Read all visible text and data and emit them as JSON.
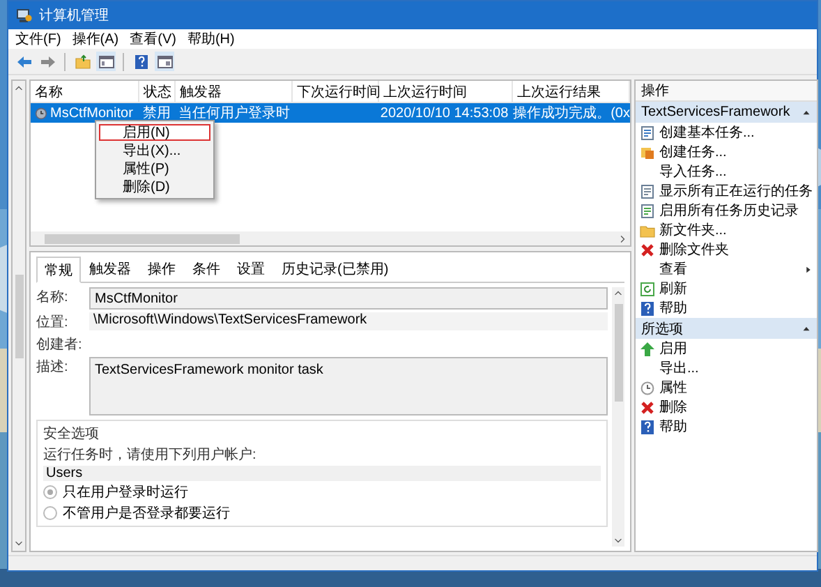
{
  "window": {
    "title": "计算机管理"
  },
  "menu": [
    "文件(F)",
    "操作(A)",
    "查看(V)",
    "帮助(H)"
  ],
  "task_list": {
    "columns": [
      "名称",
      "状态",
      "触发器",
      "下次运行时间",
      "上次运行时间",
      "上次运行结果"
    ],
    "rows": [
      {
        "name": "MsCtfMonitor",
        "status": "禁用",
        "trigger": "当任何用户登录时",
        "last_run": "2020/10/10 14:53:08",
        "last_result": "操作成功完成。(0x",
        "selected": true
      }
    ]
  },
  "context_menu": [
    {
      "label": "启用(N)",
      "selected": true
    },
    {
      "label": "导出(X)...",
      "selected": false
    },
    {
      "label": "属性(P)",
      "selected": false
    },
    {
      "label": "删除(D)",
      "selected": false
    }
  ],
  "details": {
    "tabs": [
      {
        "label": "常规",
        "selected": true
      },
      {
        "label": "触发器",
        "selected": false
      },
      {
        "label": "操作",
        "selected": false
      },
      {
        "label": "条件",
        "selected": false
      },
      {
        "label": "设置",
        "selected": false
      },
      {
        "label": "历史记录(已禁用)",
        "selected": false
      }
    ],
    "fields": [
      {
        "label": "名称:",
        "value": "MsCtfMonitor",
        "kind": "input"
      },
      {
        "label": "位置:",
        "value": "\\Microsoft\\Windows\\TextServicesFramework",
        "kind": "readonly"
      },
      {
        "label": "创建者:",
        "kind": "readonly"
      },
      {
        "label": "描述:",
        "value": "TextServicesFramework monitor task",
        "kind": "textarea"
      }
    ],
    "security": {
      "title": "安全选项",
      "prompt": "运行任务时，请使用下列用户帐户:",
      "account": "Users",
      "options": [
        {
          "label": "只在用户登录时运行",
          "selected": true
        },
        {
          "label": "不管用户是否登录都要运行",
          "selected": false
        }
      ]
    }
  },
  "actions": {
    "title": "操作",
    "sections": [
      {
        "title": "TextServicesFramework",
        "expanded": true,
        "items": [
          {
            "label": "创建基本任务...",
            "kind": "action"
          },
          {
            "label": "创建任务...",
            "kind": "action"
          },
          {
            "label": "导入任务...",
            "kind": "action"
          },
          {
            "label": "显示所有正在运行的任务",
            "kind": "action"
          },
          {
            "label": "启用所有任务历史记录",
            "kind": "action"
          },
          {
            "label": "新文件夹...",
            "kind": "action"
          },
          {
            "label": "删除文件夹",
            "kind": "action"
          },
          {
            "label": "查看",
            "kind": "submenu"
          },
          {
            "label": "刷新",
            "kind": "action"
          },
          {
            "label": "帮助",
            "kind": "action"
          }
        ]
      },
      {
        "title": "所选项",
        "expanded": true,
        "items": [
          {
            "label": "启用",
            "kind": "action"
          },
          {
            "label": "导出...",
            "kind": "action"
          },
          {
            "label": "属性",
            "kind": "action"
          },
          {
            "label": "删除",
            "kind": "action"
          },
          {
            "label": "帮助",
            "kind": "action"
          }
        ]
      }
    ]
  }
}
